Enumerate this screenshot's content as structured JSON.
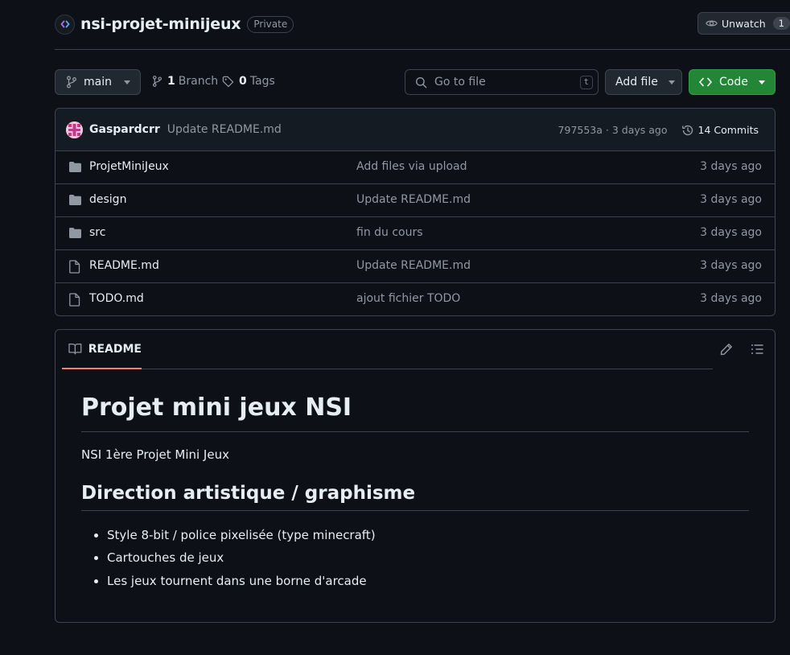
{
  "repo": {
    "name": "nsi-projet-minijeux",
    "visibility": "Private",
    "watch_label": "Unwatch",
    "watch_count": "1"
  },
  "toolbar": {
    "branch": "main",
    "branch_count": "1",
    "branch_word": "Branch",
    "tag_count": "0",
    "tag_word": "Tags",
    "search_placeholder": "Go to file",
    "search_shortcut": "t",
    "add_file_label": "Add file",
    "code_label": "Code"
  },
  "commit": {
    "author": "Gaspardcrr",
    "message": "Update README.md",
    "hash_time": "797553a · 3 days ago",
    "commits_label": "14 Commits"
  },
  "files": [
    {
      "name": "ProjetMiniJeux",
      "type": "folder",
      "message": "Add files via upload",
      "date": "3 days ago"
    },
    {
      "name": "design",
      "type": "folder",
      "message": "Update README.md",
      "date": "3 days ago"
    },
    {
      "name": "src",
      "type": "folder",
      "message": "fin du cours",
      "date": "3 days ago"
    },
    {
      "name": "README.md",
      "type": "file",
      "message": "Update README.md",
      "date": "3 days ago"
    },
    {
      "name": "TODO.md",
      "type": "file",
      "message": "ajout fichier TODO",
      "date": "3 days ago"
    }
  ],
  "readme": {
    "tab_label": "README",
    "h1": "Projet mini jeux NSI",
    "intro": "NSI 1ère Projet Mini Jeux",
    "h2": "Direction artistique / graphisme",
    "bullets": [
      "Style 8-bit / police pixelisée (type minecraft)",
      "Cartouches de jeux",
      "Les jeux tournent dans une borne d'arcade"
    ]
  },
  "colors": {
    "background": "#0d1117",
    "border": "#3d444d",
    "code_button": "#238636",
    "tab_underline": "#f78166",
    "muted_text": "#9198a1"
  }
}
